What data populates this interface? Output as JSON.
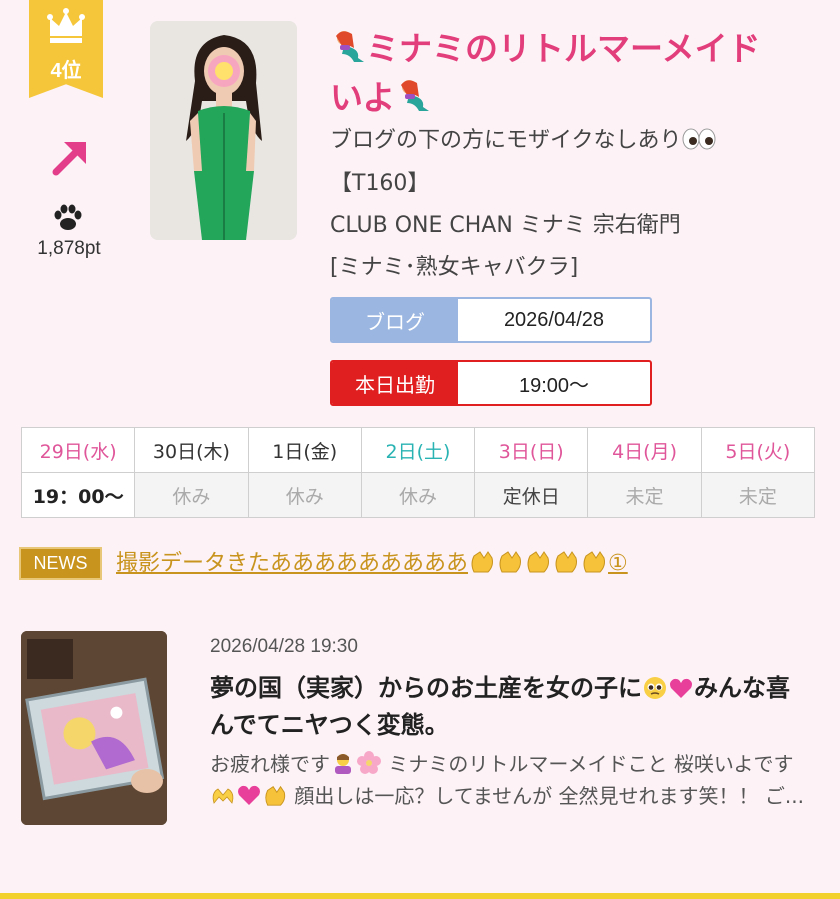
{
  "rank": {
    "label": "4位"
  },
  "trend": {
    "icon": "up-right-arrow-icon",
    "color": "#e23e8a"
  },
  "points": {
    "value": "1,878pt"
  },
  "profile": {
    "title_line1": "ミナミのリトルマーメイド",
    "title_line2": "いよ",
    "tagline": "ブログの下の方にモザイクなしあり",
    "height": "【T160】",
    "shop": "CLUB ONE CHAN ミナミ 宗右衛門",
    "category": "[ミナミ･熟女キャバクラ]"
  },
  "blog": {
    "label": "ブログ",
    "date": "2026/04/28"
  },
  "shift": {
    "label": "本日出勤",
    "time": "19:00〜"
  },
  "schedule": [
    {
      "day": "29日(水)",
      "status": "19：00〜"
    },
    {
      "day": "30日(木)",
      "status": "休み"
    },
    {
      "day": "1日(金)",
      "status": "休み"
    },
    {
      "day": "2日(土)",
      "status": "休み"
    },
    {
      "day": "3日(日)",
      "status": "定休日"
    },
    {
      "day": "4日(月)",
      "status": "未定"
    },
    {
      "day": "5日(火)",
      "status": "未定"
    }
  ],
  "news": {
    "badge": "NEWS",
    "text": "撮影データきたあああああああああ",
    "suffix": "①"
  },
  "post": {
    "datetime": "2026/04/28 19:30",
    "title_a": "夢の国（実家）からのお土産を女の子に",
    "title_b": "みんな喜んでてニヤつく変態。",
    "excerpt_a": "お疲れ様です",
    "excerpt_b": "ミナミのリトルマーメイドこと 桜咲いよです",
    "excerpt_c": "顔出しは一応？してませんが 全然見せれます笑！！ ご..."
  },
  "colors": {
    "accent_pink": "#e23e7b",
    "gold": "#c9941e",
    "blog_blue": "#9bb6e0",
    "shift_red": "#e02020"
  }
}
